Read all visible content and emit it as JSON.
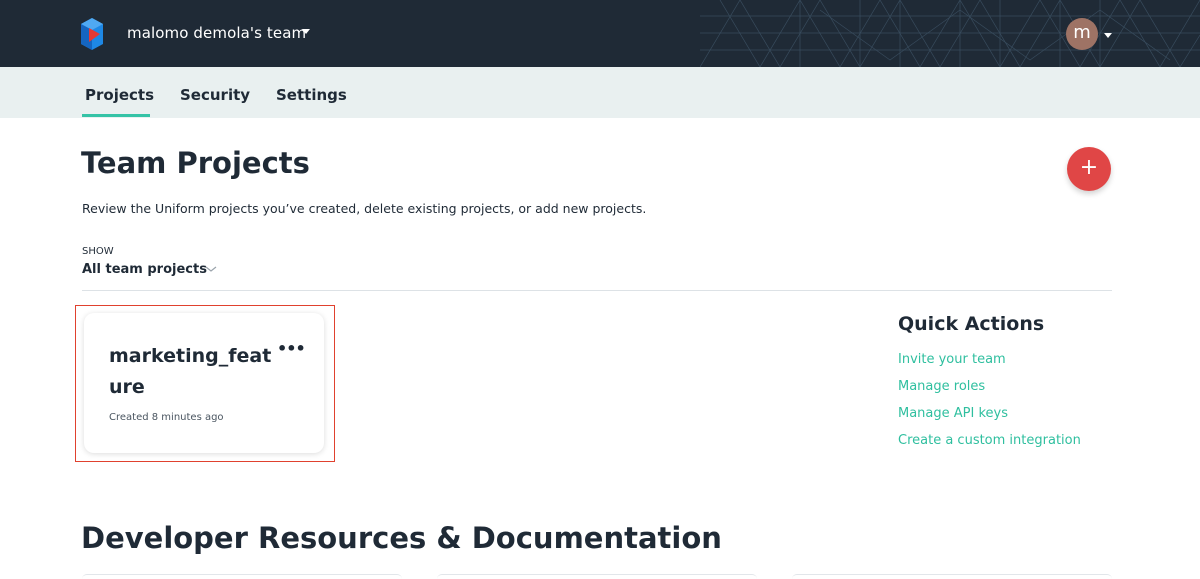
{
  "header": {
    "team_name": "malomo demola's team",
    "avatar_initial": "m",
    "avatar_color": "#9e7365"
  },
  "tabs": [
    {
      "label": "Projects",
      "active": true
    },
    {
      "label": "Security",
      "active": false
    },
    {
      "label": "Settings",
      "active": false
    }
  ],
  "main": {
    "title": "Team Projects",
    "subtitle": "Review the Uniform projects you’ve created, delete existing projects, or add new projects.",
    "add_button_label": "+",
    "filter": {
      "label": "SHOW",
      "selected": "All team projects"
    }
  },
  "projects": [
    {
      "name": "marketing_feature",
      "created": "Created 8 minutes ago",
      "menu_label": "•••"
    }
  ],
  "quick_actions": {
    "title": "Quick Actions",
    "links": [
      "Invite your team",
      "Manage roles",
      "Manage API keys",
      "Create a custom integration"
    ]
  },
  "developer_section": {
    "title": "Developer Resources & Documentation"
  },
  "colors": {
    "header_bg": "#1f2a36",
    "tab_bar_bg": "#e9f0f0",
    "accent": "#35c3a6",
    "link": "#2fbf9f",
    "add_button": "#e04646",
    "highlight": "#e0412e"
  },
  "icons": {
    "logo": "uniform-logo-icon",
    "team_dropdown": "caret-down-icon",
    "avatar_dropdown": "caret-down-icon",
    "filter_dropdown": "chevron-down-icon",
    "card_menu": "more-horizontal-icon"
  }
}
